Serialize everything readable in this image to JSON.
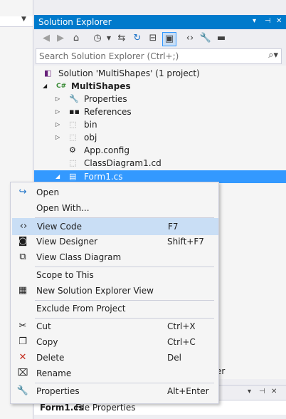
{
  "solution_explorer": {
    "title": "Solution Explorer",
    "title_buttons": [
      "▾",
      "⊣",
      "✕"
    ],
    "search_placeholder": "Search Solution Explorer (Ctrl+;)",
    "tree": {
      "solution": "Solution 'MultiShapes' (1 project)",
      "project": "MultiShapes",
      "items": [
        "Properties",
        "References",
        "bin",
        "obj",
        "App.config",
        "ClassDiagram1.cd",
        "Form1.cs"
      ]
    }
  },
  "context_menu": {
    "items": [
      {
        "label": "Open",
        "shortcut": "",
        "icon": "open-arrow-icon"
      },
      {
        "label": "Open With...",
        "shortcut": "",
        "icon": ""
      },
      {
        "label": "View Code",
        "shortcut": "F7",
        "icon": "code-brackets-icon"
      },
      {
        "label": "View Designer",
        "shortcut": "Shift+F7",
        "icon": "designer-icon"
      },
      {
        "label": "View Class Diagram",
        "shortcut": "",
        "icon": "class-diagram-icon"
      },
      {
        "label": "Scope to This",
        "shortcut": "",
        "icon": ""
      },
      {
        "label": "New Solution Explorer View",
        "shortcut": "",
        "icon": "new-view-icon"
      },
      {
        "label": "Exclude From Project",
        "shortcut": "",
        "icon": ""
      },
      {
        "label": "Cut",
        "shortcut": "Ctrl+X",
        "icon": "scissors-icon"
      },
      {
        "label": "Copy",
        "shortcut": "Ctrl+C",
        "icon": "copy-icon"
      },
      {
        "label": "Delete",
        "shortcut": "Del",
        "icon": "delete-x-icon"
      },
      {
        "label": "Rename",
        "shortcut": "",
        "icon": "rename-icon"
      },
      {
        "label": "Properties",
        "shortcut": "Alt+Enter",
        "icon": "wrench-icon"
      }
    ]
  },
  "background_tab_text": "er",
  "properties_panel": {
    "title_buttons": [
      "▾",
      "⊣",
      "✕"
    ],
    "object_name": "Form1.cs",
    "object_type": "File Properties"
  },
  "colors": {
    "accent": "#007acc",
    "selection": "#3399ff",
    "menu_hover": "#c9def5"
  }
}
